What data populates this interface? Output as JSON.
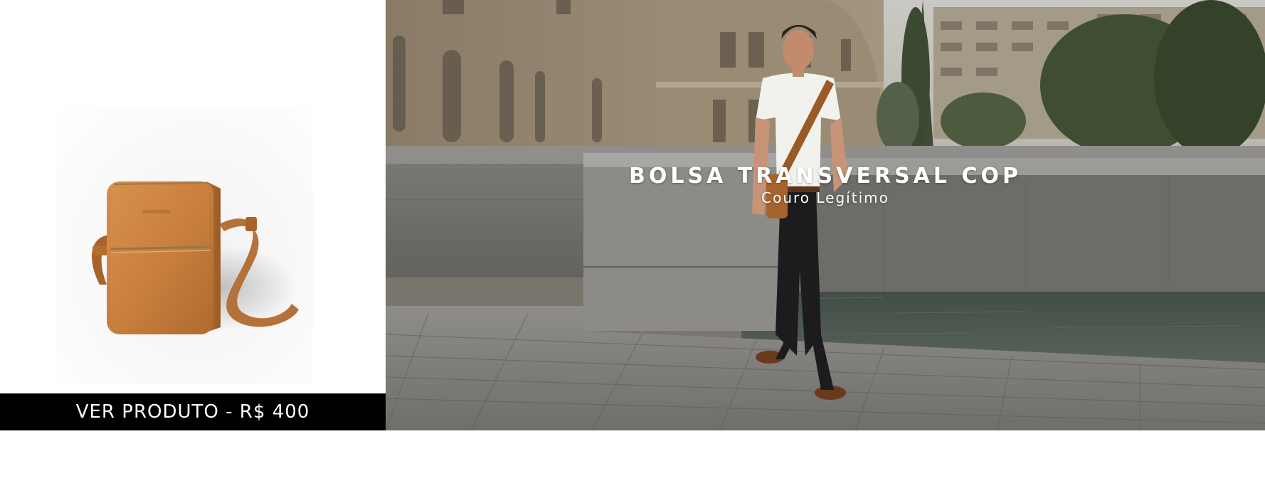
{
  "product_card": {
    "cta_label": "VER PRODUTO - R$ 400",
    "image": "leather-crossbody-bag",
    "bag_color": "#c9803f"
  },
  "hero": {
    "title": "BOLSA TRANSVERSAL COP",
    "subtitle": "Couro Legítimo",
    "image": "man-walking-riverside-with-crossbody-bag"
  },
  "colors": {
    "cta_background": "#000000",
    "cta_text": "#ffffff",
    "hero_text": "#ffffff"
  }
}
